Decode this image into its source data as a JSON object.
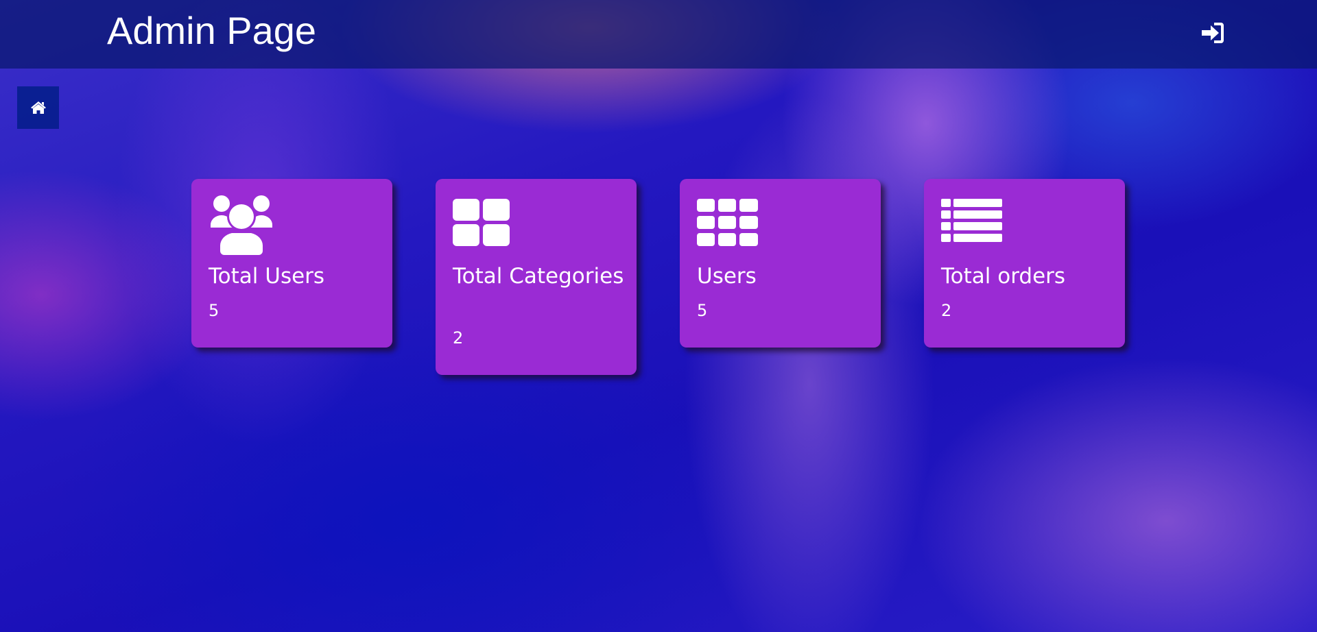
{
  "header": {
    "title": "Admin Page"
  },
  "nav": {
    "home_icon": "home-icon",
    "login_icon": "sign-in-icon"
  },
  "cards": [
    {
      "icon": "users-group-icon",
      "label": "Total Users",
      "value": "5"
    },
    {
      "icon": "large-grid-icon",
      "label": "Total Categories",
      "value": "2"
    },
    {
      "icon": "small-grid-icon",
      "label": "Users",
      "value": "5"
    },
    {
      "icon": "list-icon",
      "label": "Total orders",
      "value": "2"
    }
  ],
  "colors": {
    "card_background": "#9a2bd4",
    "topbar_background": "#08186e",
    "text": "#ffffff"
  }
}
